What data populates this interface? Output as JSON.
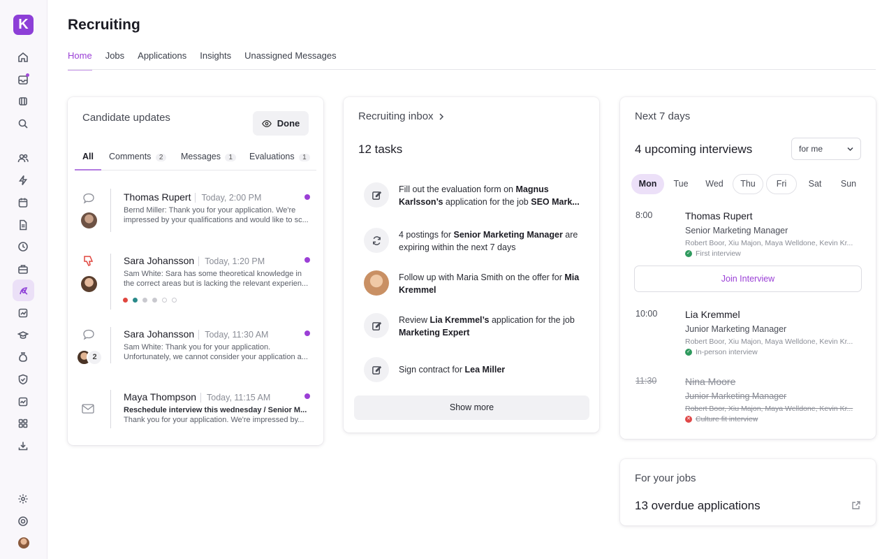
{
  "sidebar": {
    "logo_letter": "K",
    "icons": [
      "home-icon",
      "inbox-icon",
      "grid-icon",
      "search-icon",
      "users-icon",
      "bolt-icon",
      "calendar-icon",
      "document-icon",
      "clock-icon",
      "briefcase-icon",
      "recruiting-icon",
      "chart-icon",
      "graduation-cap-icon",
      "money-bag-icon",
      "shield-icon",
      "analytics-icon",
      "apps-icon",
      "download-icon",
      "settings-icon",
      "help-icon"
    ],
    "accent": "#8d3fd7"
  },
  "page": {
    "title": "Recruiting",
    "tabs": [
      "Home",
      "Jobs",
      "Applications",
      "Insights",
      "Unassigned Messages"
    ]
  },
  "candidate_updates": {
    "title": "Candidate updates",
    "done_label": "Done",
    "filters": [
      {
        "label": "All",
        "count": ""
      },
      {
        "label": "Comments",
        "count": "2"
      },
      {
        "label": "Messages",
        "count": "1"
      },
      {
        "label": "Evaluations",
        "count": "1"
      }
    ],
    "items": [
      {
        "name": "Thomas Rupert",
        "time": "Today, 2:00 PM",
        "text": "Bernd Miller: Thank you for your application. We're",
        "text2": "impressed by your qualifications and would like to sc...",
        "icon": "comment-icon"
      },
      {
        "name": "Sara Johansson",
        "time": "Today, 1:20 PM",
        "text": "Sam White: Sara has some theoretical knowledge in",
        "text2": "the correct areas but is lacking the relevant experien...",
        "icon": "thumbs-down-icon"
      },
      {
        "name": "Sara Johansson",
        "time": "Today, 11:30 AM",
        "text": "Sam White: Thank you for your application.",
        "text2": "Unfortunately, we cannot consider your application a...",
        "icon": "comment-icon",
        "avatar_count": "2"
      },
      {
        "name": "Maya Thompson",
        "time": "Today, 11:15 AM",
        "text": "Reschedule interview this wednesday / Senior M...",
        "text2": "Thank you for your application. We're impressed by...",
        "icon": "mail-icon"
      }
    ]
  },
  "inbox": {
    "title": "Recruiting inbox",
    "count_label": "12 tasks",
    "show_more": "Show more",
    "tasks": [
      {
        "pre": "Fill out the evaluation form on ",
        "b1": "Magnus Karlsson’s",
        "mid": " application for the job ",
        "b2": "SEO Mark..."
      },
      {
        "pre": "4 postings for ",
        "b1": "Senior Marketing Manager",
        "mid": " are expiring within the next 7 days",
        "b2": ""
      },
      {
        "pre": "Follow up with Maria Smith on the offer for ",
        "b1": "Mia Kremmel",
        "mid": "",
        "b2": ""
      },
      {
        "pre": "Review ",
        "b1": "Lia Kremmel’s",
        "mid": " application for the job ",
        "b2": "Marketing Expert"
      },
      {
        "pre": "Sign contract for ",
        "b1": "Lea Miller",
        "mid": "",
        "b2": ""
      }
    ]
  },
  "next7": {
    "title": "Next 7 days",
    "headline": "4 upcoming interviews",
    "filter_value": "for me",
    "days": [
      "Mon",
      "Tue",
      "Wed",
      "Thu",
      "Fri",
      "Sat",
      "Sun"
    ],
    "join_label": "Join Interview",
    "interviews": [
      {
        "time": "8:00",
        "name": "Thomas Rupert",
        "role": "Senior Marketing Manager",
        "people": "Robert Boor, Xiu Majon, Maya Welldone, Kevin Kr...",
        "type": "First interview"
      },
      {
        "time": "10:00",
        "name": "Lia Kremmel",
        "role": "Junior Marketing Manager",
        "people": "Robert Boor, Xiu Majon, Maya Welldone, Kevin Kr...",
        "type": "In-person interview"
      },
      {
        "time": "11:30",
        "name": "Nina Moore",
        "role": "Junior Marketing Manager",
        "people": "Robert Boor, Xiu Majon, Maya Welldone, Kevin Kr...",
        "type": "Culture fit interview"
      }
    ]
  },
  "jobs": {
    "title": "For your jobs",
    "headline": "13 overdue applications"
  }
}
